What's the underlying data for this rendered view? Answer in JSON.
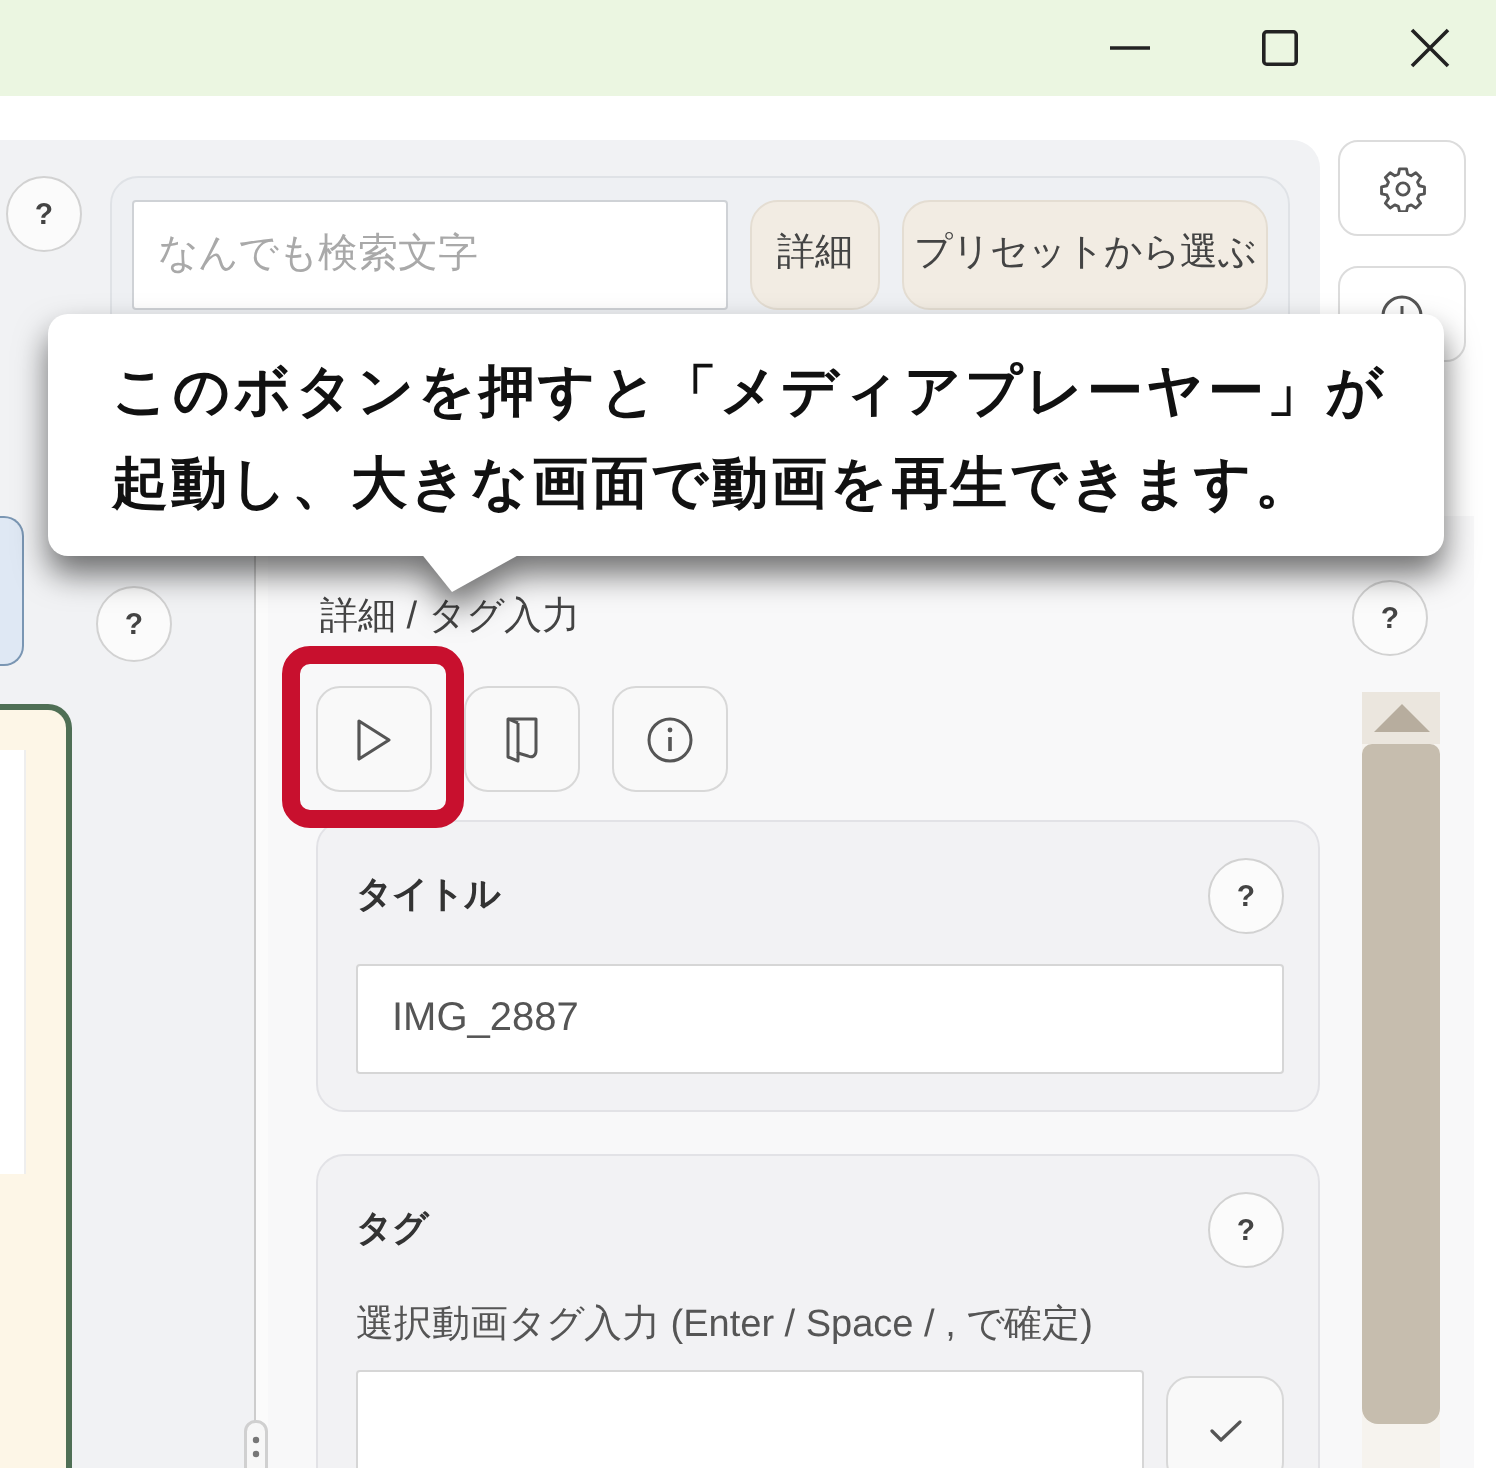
{
  "search": {
    "help": "?",
    "placeholder": "なんでも検索文字",
    "buttons": [
      "詳細",
      "プリセットから選ぶ"
    ]
  },
  "callout": {
    "text": "このボタンを押すと「メディアプレーヤー」が起動し、大きな画面で動画を再生できます。"
  },
  "side_panel": {
    "help": "?"
  },
  "details": {
    "title": "詳細 / タグ入力",
    "help": "?",
    "tools": [
      {
        "kind": "play",
        "highlighted": true
      },
      {
        "kind": "book",
        "highlighted": false
      },
      {
        "kind": "info",
        "highlighted": false
      }
    ]
  },
  "title_field": {
    "label": "タイトル",
    "help": "?",
    "value": "IMG_2887"
  },
  "tag_field": {
    "label": "タグ",
    "help": "?",
    "hint": "選択動画タグ入力 (Enter / Space / , で確定)"
  }
}
